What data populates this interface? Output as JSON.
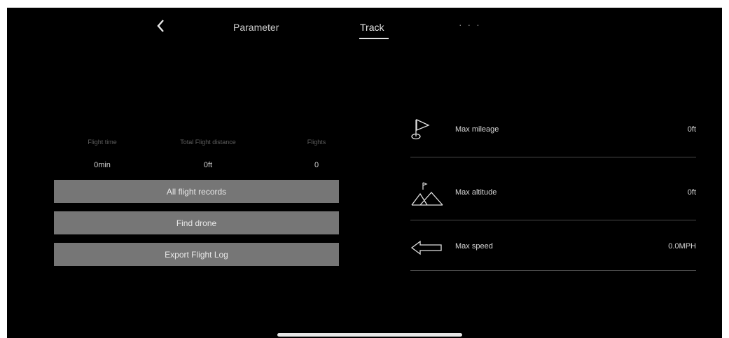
{
  "nav": {
    "tabs": [
      {
        "label": "Parameter",
        "active": false
      },
      {
        "label": "Track",
        "active": true
      }
    ],
    "more_label": "· · ·",
    "back_icon": "chevron-left-icon"
  },
  "stats": [
    {
      "label": "Flight time",
      "value": "0min"
    },
    {
      "label": "Total Flight distance",
      "value": "0ft"
    },
    {
      "label": "Flights",
      "value": "0"
    }
  ],
  "buttons": {
    "all_records": "All flight records",
    "find_drone": "Find drone",
    "export_log": "Export Flight Log"
  },
  "metrics": [
    {
      "label": "Max mileage",
      "value": "0ft",
      "icon": "flag-icon"
    },
    {
      "label": "Max altitude",
      "value": "0ft",
      "icon": "mountain-icon"
    },
    {
      "label": "Max speed",
      "value": "0.0MPH",
      "icon": "arrow-left-icon"
    }
  ],
  "colors": {
    "background": "#000000",
    "button": "#767676",
    "divider": "#4a4a4a"
  }
}
